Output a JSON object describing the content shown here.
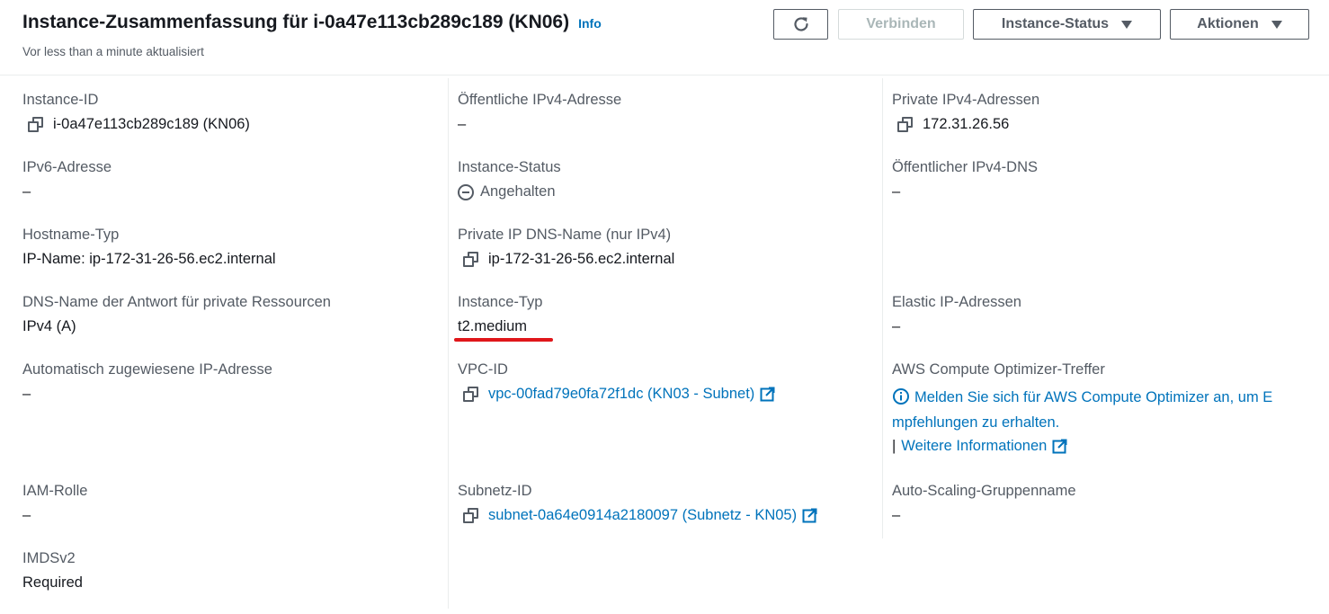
{
  "header": {
    "title": "Instance-Zusammenfassung für i-0a47e113cb289c189 (KN06)",
    "info_label": "Info",
    "subtitle": "Vor less than a minute aktualisiert",
    "buttons": {
      "connect": "Verbinden",
      "instance_status": "Instance-Status",
      "actions": "Aktionen"
    }
  },
  "col1": {
    "instance_id": {
      "label": "Instance-ID",
      "value": "i-0a47e113cb289c189 (KN06)"
    },
    "ipv6": {
      "label": "IPv6-Adresse",
      "value": "–"
    },
    "hostname_type": {
      "label": "Hostname-Typ",
      "value": "IP-Name: ip-172-31-26-56.ec2.internal"
    },
    "dns_answer": {
      "label": "DNS-Name der Antwort für private Ressourcen",
      "value": "IPv4 (A)"
    },
    "auto_ip": {
      "label": "Automatisch zugewiesene IP-Adresse",
      "value": "–"
    },
    "iam_role": {
      "label": "IAM-Rolle",
      "value": "–"
    },
    "imdsv2": {
      "label": "IMDSv2",
      "value": "Required"
    }
  },
  "col2": {
    "public_ipv4": {
      "label": "Öffentliche IPv4-Adresse",
      "value": "–"
    },
    "instance_status": {
      "label": "Instance-Status",
      "value": "Angehalten"
    },
    "private_dns": {
      "label": "Private IP DNS-Name (nur IPv4)",
      "value": "ip-172-31-26-56.ec2.internal"
    },
    "instance_type": {
      "label": "Instance-Typ",
      "value": "t2.medium"
    },
    "vpc_id": {
      "label": "VPC-ID",
      "value": "vpc-00fad79e0fa72f1dc (KN03 - Subnet)"
    },
    "subnet_id": {
      "label": "Subnetz-ID",
      "value": "subnet-0a64e0914a2180097 (Subnetz - KN05)"
    }
  },
  "col3": {
    "private_ipv4": {
      "label": "Private IPv4-Adressen",
      "value": "172.31.26.56"
    },
    "public_dns": {
      "label": "Öffentlicher IPv4-DNS",
      "value": "–"
    },
    "elastic_ip": {
      "label": "Elastic IP-Adressen",
      "value": "–"
    },
    "optimizer": {
      "label": "AWS Compute Optimizer-Treffer",
      "line1": "Melden Sie sich für AWS Compute Optimizer an, um E",
      "line2": "mpfehlungen zu erhalten.",
      "separator": "|",
      "more_info": "Weitere Informationen"
    },
    "auto_scaling": {
      "label": "Auto-Scaling-Gruppenname",
      "value": "–"
    }
  },
  "colors": {
    "link": "#0073bb",
    "highlight_underline": "#e0161a",
    "label": "#545b64",
    "text": "#16191f"
  }
}
